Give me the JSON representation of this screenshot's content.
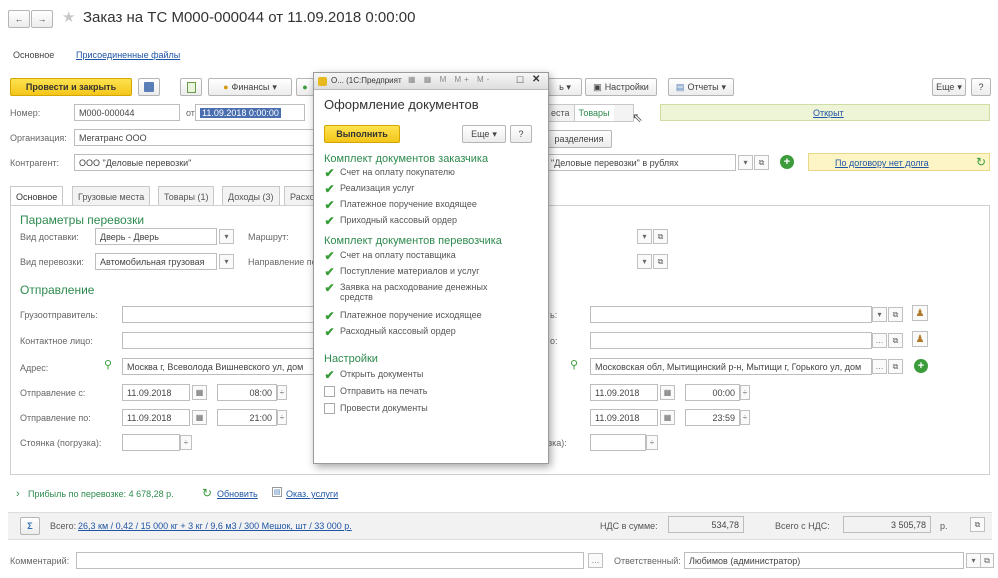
{
  "title": "Заказ на ТС М000-000044 от 11.09.2018 0:00:00",
  "nav_back": "←",
  "nav_fwd": "→",
  "star": "★",
  "tabs_top": {
    "main": "Основное",
    "files": "Присоединенные файлы"
  },
  "toolbar": {
    "post_close": "Провести и закрыть",
    "finance": "Финансы",
    "settings": "Настройки",
    "reports": "Отчеты",
    "more": "Еще",
    "help": "?"
  },
  "header": {
    "number_label": "Номер:",
    "number": "М000-000044",
    "from_label": "от:",
    "date": "11.09.2018 0:00:00",
    "org_label": "Организация:",
    "org": "Мегатранс ООО",
    "contractor_label": "Контрагент:",
    "contractor": "ООО \"Деловые перевозки\"",
    "contract": "\"Деловые перевозки\" в рублях",
    "debt_link": "По договору нет долга",
    "status": "Открыт",
    "sub_right": "разделения"
  },
  "doc_tabs": [
    "Основное",
    "Грузовые места",
    "Товары (1)",
    "Доходы (3)",
    "Расхо"
  ],
  "right_tabs": [
    "еста",
    "Товары"
  ],
  "params": {
    "heading": "Параметры перевозки",
    "delivery_label": "Вид доставки:",
    "delivery": "Дверь - Дверь",
    "route_label": "Маршрут:",
    "transport_label": "Вид перевозки:",
    "transport": "Автомобильная грузовая",
    "direction_label": "Направление пе"
  },
  "departure": {
    "heading": "Отправление",
    "shipper_label": "Грузоотправитель:",
    "contact_label": "Контактное лицо:",
    "address_label": "Адрес:",
    "address": "Москва г, Всеволода Вишневского ул, дом",
    "dep_from_label": "Отправление с:",
    "dep_to_label": "Отправление по:",
    "parking_label": "Стоянка (погрузка):",
    "date1": "11.09.2018",
    "time1": "08:00",
    "date2": "11.09.2018",
    "time2": "21:00"
  },
  "arrival": {
    "address": "Московская обл, Мытищинский р-н, Мытищи г, Горького ул, дом",
    "date1": "11.09.2018",
    "time1": "00:00",
    "date2": "11.09.2018",
    "time2": "23:59",
    "parking_suffix": "зка):",
    "cut1": "ь:",
    "cut2": "о:"
  },
  "profit": {
    "text": "Прибыль по перевозке: 4 678,28 р.",
    "refresh": "Обновить",
    "service": "Оказ. услуги"
  },
  "totals": {
    "sigma": "Σ",
    "total_label": "Всего:",
    "total_link": "26,3 км / 0,42 / 15 000 кг + 3 кг / 9,6 м3 / 300 Мешок, шт / 33 000 р.",
    "vat_label": "НДС в сумме:",
    "vat": "534,78",
    "with_vat_label": "Всего с НДС:",
    "with_vat": "3 505,78",
    "currency": "р."
  },
  "footer": {
    "comment_label": "Комментарий:",
    "responsible_label": "Ответственный:",
    "responsible": "Любимов (администратор)"
  },
  "dialog": {
    "window_title": "О... (1С:Предприят",
    "heading": "Оформление документов",
    "execute": "Выполнить",
    "more": "Еще",
    "help": "?",
    "groups": [
      {
        "title": "Комплект документов заказчика",
        "items": [
          {
            "label": "Счет на оплату покупателю",
            "checked": true
          },
          {
            "label": "Реализация услуг",
            "checked": true
          },
          {
            "label": "Платежное поручение входящее",
            "checked": true
          },
          {
            "label": "Приходный кассовый ордер",
            "checked": true
          }
        ]
      },
      {
        "title": "Комплект документов перевозчика",
        "items": [
          {
            "label": "Счет на оплату поставщика",
            "checked": true
          },
          {
            "label": "Поступление материалов и услуг",
            "checked": true
          },
          {
            "label": "Заявка на расходование денежных\nсредств",
            "checked": true
          },
          {
            "label": "Платежное поручение исходящее",
            "checked": true
          },
          {
            "label": "Расходный кассовый ордер",
            "checked": true
          }
        ]
      },
      {
        "title": "Настройки",
        "items": [
          {
            "label": "Открыть документы",
            "checked": true
          },
          {
            "label": "Отправить на печать",
            "checked": false
          },
          {
            "label": "Провести документы",
            "checked": false
          }
        ]
      }
    ]
  },
  "colors": {
    "accent_green": "#2d8a4e",
    "yellow": "#f4c51b",
    "link": "#1f55a5"
  }
}
